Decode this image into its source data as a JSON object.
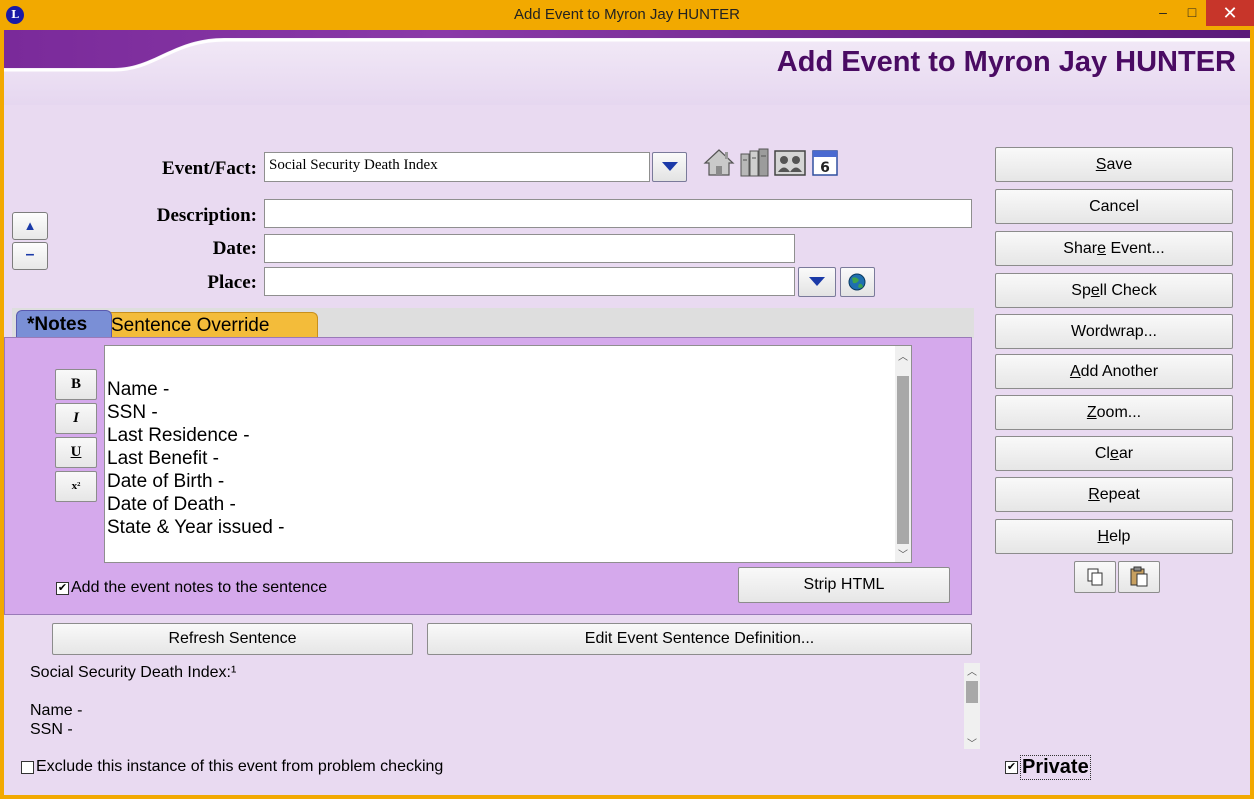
{
  "window": {
    "title": "Add Event to Myron Jay HUNTER",
    "logo_letter": "L",
    "minimize_glyph": "–",
    "maximize_glyph": "□",
    "close_glyph": "✕"
  },
  "header": {
    "title": "Add Event to Myron Jay HUNTER"
  },
  "form": {
    "event_fact_label": "Event/Fact:",
    "event_fact_value": "Social Security Death Index",
    "description_label": "Description:",
    "description_value": "",
    "date_label": "Date:",
    "date_value": "",
    "place_label": "Place:",
    "place_value": ""
  },
  "icons": [
    "home-icon",
    "library-icon",
    "people-icon",
    "calendar-icon",
    "globe-icon",
    "copy-icon",
    "paste-icon"
  ],
  "calendar_digit": "6",
  "updown": {
    "up": "▲",
    "down": "–"
  },
  "tabs": [
    {
      "label": "*Notes",
      "active": true
    },
    {
      "label": "Sentence Override",
      "active": false
    }
  ],
  "format_buttons": {
    "bold": "B",
    "italic": "I",
    "underline": "U",
    "superscript": "x²"
  },
  "notes": {
    "lines": "Name -\nSSN -\nLast Residence -\nLast Benefit -\nDate of Birth -\nDate of Death -\nState & Year issued -",
    "add_to_sentence_label": "Add the event notes to the sentence",
    "add_to_sentence_checked": true,
    "strip_html_label": "Strip HTML"
  },
  "sentence": {
    "refresh_label": "Refresh Sentence",
    "edit_definition_label": "Edit Event Sentence Definition...",
    "text": "Social Security Death Index:¹\n\nName -\nSSN -"
  },
  "exclude_label": "Exclude this instance of this event from problem checking",
  "exclude_checked": false,
  "private_label": "Private",
  "private_checked": true,
  "side_buttons": {
    "save": {
      "pre": "",
      "u": "S",
      "post": "ave"
    },
    "cancel": {
      "pre": "Cancel",
      "u": "",
      "post": ""
    },
    "share": {
      "pre": "Shar",
      "u": "e",
      "post": " Event..."
    },
    "spell": {
      "pre": "Sp",
      "u": "e",
      "post": "ll Check"
    },
    "wordwrap": {
      "pre": "Wordwrap...",
      "u": "",
      "post": ""
    },
    "addanother": {
      "pre": "",
      "u": "A",
      "post": "dd Another"
    },
    "zoom": {
      "pre": "",
      "u": "Z",
      "post": "oom..."
    },
    "clear": {
      "pre": "Cl",
      "u": "e",
      "post": "ar"
    },
    "repeat": {
      "pre": "",
      "u": "R",
      "post": "epeat"
    },
    "help": {
      "pre": "",
      "u": "H",
      "post": "elp"
    }
  },
  "colors": {
    "titlebar": "#f2a900",
    "client_bg": "#e9daf1",
    "title_text": "#4a0b63",
    "notes_panel": "#d5a9ec",
    "notes_tab": "#7a8fd6",
    "sentence_tab": "#f3bc3a"
  }
}
